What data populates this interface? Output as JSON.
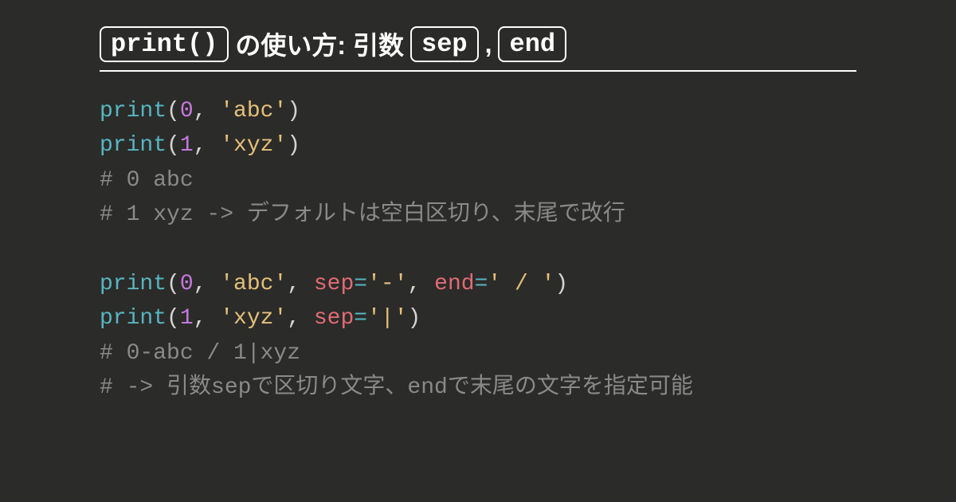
{
  "title": {
    "box1": "print()",
    "text1": " の使い方: 引数 ",
    "box2": "sep",
    "comma": " , ",
    "box3": "end"
  },
  "code": {
    "l1": {
      "fn": "print",
      "p1": "(",
      "n": "0",
      "c": ", ",
      "s": "'abc'",
      "p2": ")"
    },
    "l2": {
      "fn": "print",
      "p1": "(",
      "n": "1",
      "c": ", ",
      "s": "'xyz'",
      "p2": ")"
    },
    "l3": "# 0 abc",
    "l4": "# 1 xyz -> デフォルトは空白区切り、末尾で改行",
    "l6": {
      "fn": "print",
      "p1": "(",
      "n": "0",
      "c1": ", ",
      "s1": "'abc'",
      "c2": ", ",
      "k1": "sep",
      "e1": "=",
      "v1": "'-'",
      "c3": ", ",
      "k2": "end",
      "e2": "=",
      "v2": "' / '",
      "p2": ")"
    },
    "l7": {
      "fn": "print",
      "p1": "(",
      "n": "1",
      "c1": ", ",
      "s1": "'xyz'",
      "c2": ", ",
      "k1": "sep",
      "e1": "=",
      "v1": "'|'",
      "p2": ")"
    },
    "l8": "# 0-abc / 1|xyz",
    "l9": "# -> 引数sepで区切り文字、endで末尾の文字を指定可能"
  }
}
